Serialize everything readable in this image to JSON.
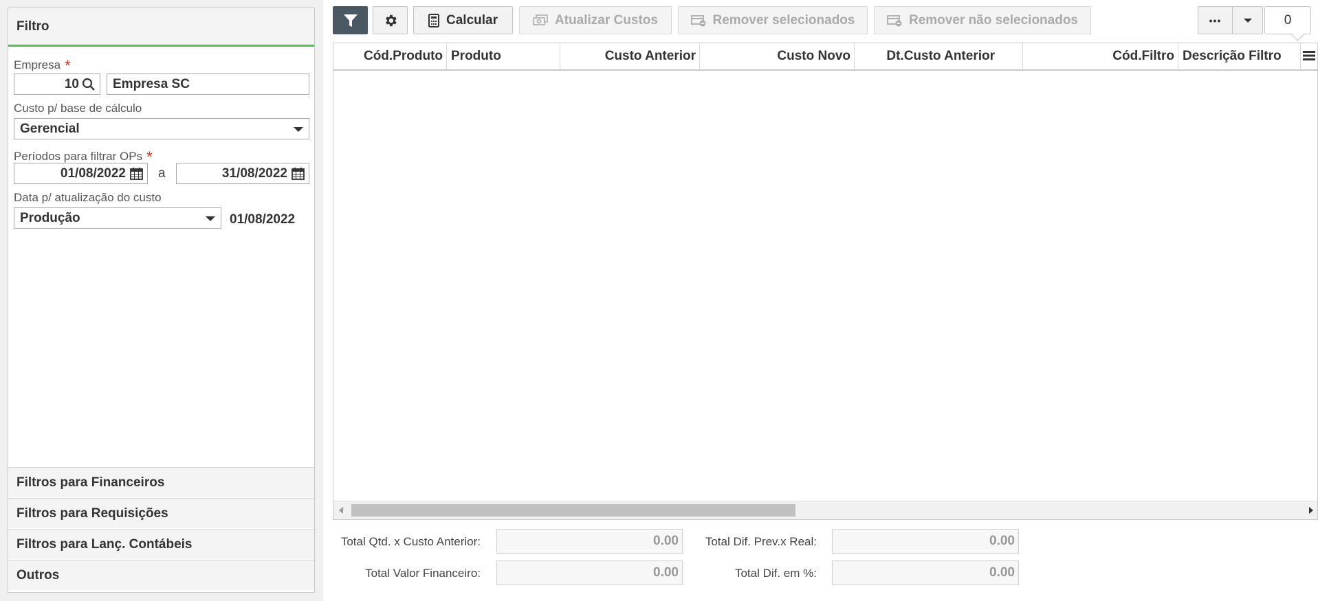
{
  "filter_panel": {
    "title": "Filtro",
    "empresa_label": "Empresa",
    "required_mark": "*",
    "empresa_code": "10",
    "empresa_name": "Empresa SC",
    "custo_label": "Custo p/ base de cálculo",
    "custo_value": "Gerencial",
    "periodos_label": "Períodos para filtrar OPs",
    "date_from": "01/08/2022",
    "date_sep": "a",
    "date_to": "31/08/2022",
    "data_label": "Data p/ atualização do custo",
    "data_mode": "Produção",
    "data_value": "01/08/2022"
  },
  "accordion": [
    "Filtros para Financeiros",
    "Filtros para Requisições",
    "Filtros para Lanç. Contábeis",
    "Outros"
  ],
  "toolbar": {
    "calcular": "Calcular",
    "atualizar": "Atualizar Custos",
    "remover_sel": "Remover selecionados",
    "remover_nao_sel": "Remover não selecionados",
    "more": "•••",
    "count": "0"
  },
  "grid": {
    "columns": [
      "Cód.Produto",
      "Produto",
      "Custo Anterior",
      "Custo Novo",
      "Dt.Custo Anterior",
      "Cód.Filtro",
      "Descrição Filtro"
    ]
  },
  "totals": {
    "qtd_custo_label": "Total Qtd. x Custo Anterior:",
    "qtd_custo_value": "0.00",
    "dif_prev_label": "Total Dif. Prev.x Real:",
    "dif_prev_value": "0.00",
    "valor_fin_label": "Total Valor Financeiro:",
    "valor_fin_value": "0.00",
    "dif_pct_label": "Total Dif. em %:",
    "dif_pct_value": "0.00"
  }
}
